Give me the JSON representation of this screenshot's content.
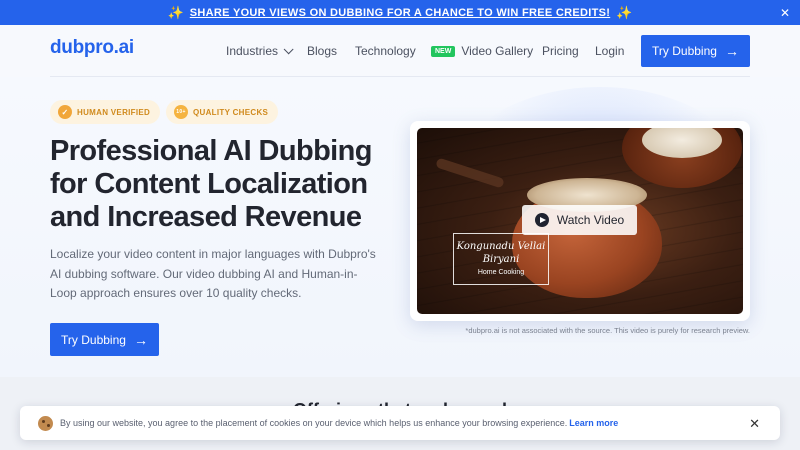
{
  "announcement": {
    "text": "SHARE YOUR VIEWS ON DUBBING FOR A CHANCE TO WIN FREE CREDITS!",
    "close": "✕"
  },
  "nav": {
    "logo": "dubpro.ai",
    "items": [
      {
        "label": "Industries"
      },
      {
        "label": "Blogs"
      },
      {
        "label": "Technology"
      },
      {
        "label": "Video Gallery",
        "badge": "NEW"
      },
      {
        "label": "Pricing"
      },
      {
        "label": "Login"
      }
    ],
    "cta": "Try Dubbing"
  },
  "hero": {
    "badges": [
      {
        "label": "HUMAN VERIFIED",
        "icon": "check-badge-icon"
      },
      {
        "label": "QUALITY CHECKS",
        "icon_text": "10+"
      }
    ],
    "title": "Professional AI Dubbing for Content Localization and Increased Revenue",
    "description": "Localize your video content in major languages with Dubpro's AI dubbing software. Our video dubbing AI and Human-in-Loop approach ensures over 10 quality checks.",
    "cta": "Try Dubbing"
  },
  "video": {
    "watch_label": "Watch Video",
    "overlay_title": "Kongunadu Vellai Biryani",
    "overlay_subtitle": "Home Cooking",
    "disclaimer": "*dubpro.ai is not associated with the source. This video is purely for research preview."
  },
  "section": {
    "title": "Offerings that go beyond"
  },
  "cookie": {
    "text": "By using our website, you agree to the placement of cookies on your device which helps us enhance your browsing experience.",
    "link": "Learn more",
    "close": "✕"
  },
  "colors": {
    "primary": "#2563eb",
    "badge_bg": "#fdf3e0",
    "badge_text": "#d08a1d",
    "new_badge": "#22c55e"
  }
}
